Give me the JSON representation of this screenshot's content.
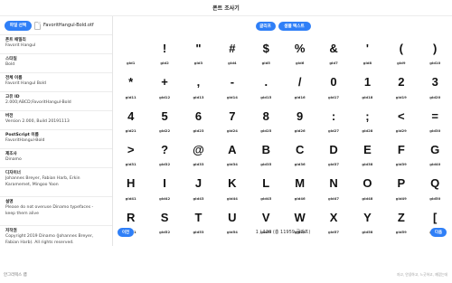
{
  "window": {
    "title": "폰트 조사기"
  },
  "file": {
    "select_label": "파일 선택",
    "file_name": "FavoritHangul-Bold.otf"
  },
  "info": [
    {
      "key": "폰트 패밀리",
      "lines": [
        "Favorit Hangul"
      ]
    },
    {
      "key": "스타일",
      "lines": [
        "Bold"
      ]
    },
    {
      "key": "전체 이름",
      "lines": [
        "Favorit Hangul Bold"
      ]
    },
    {
      "key": "고유 ID",
      "lines": [
        "2.000;ABCD;FavoritHangul-Bold"
      ]
    },
    {
      "key": "버전",
      "lines": [
        "Version 2.000, Build 20191113"
      ]
    },
    {
      "key": "PostScript 이름",
      "lines": [
        "FavoritHangul-Bold"
      ]
    },
    {
      "key": "제조사",
      "lines": [
        "Dinamo"
      ]
    },
    {
      "key": "디자이너",
      "lines": [
        "Johannes Breyer, Fabian Harb, Erkin",
        "Karamemet, Mingoo Yoon"
      ]
    },
    {
      "key": "설명",
      "lines": [
        "Please do not overuse Dinamo typefaces -",
        "keep them alive"
      ]
    },
    {
      "key": "저작권",
      "lines": [
        "Copyright 2019 Dinamo (Johannes Breyer,",
        "Fabian Harb). All rights reserved."
      ]
    }
  ],
  "toolbar": {
    "filter_label": "글리프",
    "sample_label": "샘플 텍스트"
  },
  "glyphs": [
    {
      "char": "",
      "gid": "gid1"
    },
    {
      "char": "!",
      "gid": "gid2"
    },
    {
      "char": "\"",
      "gid": "gid3"
    },
    {
      "char": "#",
      "gid": "gid4"
    },
    {
      "char": "$",
      "gid": "gid5"
    },
    {
      "char": "%",
      "gid": "gid6"
    },
    {
      "char": "&",
      "gid": "gid7"
    },
    {
      "char": "'",
      "gid": "gid8"
    },
    {
      "char": "(",
      "gid": "gid9"
    },
    {
      "char": ")",
      "gid": "gid10"
    },
    {
      "char": "*",
      "gid": "gid11"
    },
    {
      "char": "+",
      "gid": "gid12"
    },
    {
      "char": ",",
      "gid": "gid13"
    },
    {
      "char": "-",
      "gid": "gid14"
    },
    {
      "char": ".",
      "gid": "gid15"
    },
    {
      "char": "/",
      "gid": "gid16"
    },
    {
      "char": "0",
      "gid": "gid17"
    },
    {
      "char": "1",
      "gid": "gid18"
    },
    {
      "char": "2",
      "gid": "gid19"
    },
    {
      "char": "3",
      "gid": "gid20"
    },
    {
      "char": "4",
      "gid": "gid21"
    },
    {
      "char": "5",
      "gid": "gid22"
    },
    {
      "char": "6",
      "gid": "gid23"
    },
    {
      "char": "7",
      "gid": "gid24"
    },
    {
      "char": "8",
      "gid": "gid25"
    },
    {
      "char": "9",
      "gid": "gid26"
    },
    {
      "char": ":",
      "gid": "gid27"
    },
    {
      "char": ";",
      "gid": "gid28"
    },
    {
      "char": "<",
      "gid": "gid29"
    },
    {
      "char": "=",
      "gid": "gid30"
    },
    {
      "char": ">",
      "gid": "gid31"
    },
    {
      "char": "?",
      "gid": "gid32"
    },
    {
      "char": "@",
      "gid": "gid33"
    },
    {
      "char": "A",
      "gid": "gid34"
    },
    {
      "char": "B",
      "gid": "gid35"
    },
    {
      "char": "C",
      "gid": "gid36"
    },
    {
      "char": "D",
      "gid": "gid37"
    },
    {
      "char": "E",
      "gid": "gid38"
    },
    {
      "char": "F",
      "gid": "gid39"
    },
    {
      "char": "G",
      "gid": "gid40"
    },
    {
      "char": "H",
      "gid": "gid41"
    },
    {
      "char": "I",
      "gid": "gid42"
    },
    {
      "char": "J",
      "gid": "gid43"
    },
    {
      "char": "K",
      "gid": "gid44"
    },
    {
      "char": "L",
      "gid": "gid45"
    },
    {
      "char": "M",
      "gid": "gid46"
    },
    {
      "char": "N",
      "gid": "gid47"
    },
    {
      "char": "O",
      "gid": "gid48"
    },
    {
      "char": "P",
      "gid": "gid49"
    },
    {
      "char": "Q",
      "gid": "gid50"
    },
    {
      "char": "R",
      "gid": "gid51"
    },
    {
      "char": "S",
      "gid": "gid52"
    },
    {
      "char": "T",
      "gid": "gid53"
    },
    {
      "char": "U",
      "gid": "gid54"
    },
    {
      "char": "V",
      "gid": "gid55"
    },
    {
      "char": "W",
      "gid": "gid56"
    },
    {
      "char": "X",
      "gid": "gid57"
    },
    {
      "char": "Y",
      "gid": "gid58"
    },
    {
      "char": "Z",
      "gid": "gid59"
    },
    {
      "char": "[",
      "gid": "gid60"
    }
  ],
  "pager": {
    "prev_label": "이전",
    "page_info": "1 / 120 (총 11959 글리프)",
    "next_label": "다음"
  },
  "footer": {
    "left": "안그라픽스 랩",
    "right": "자고, 안녕하고, 느긋하고, 재밌는데"
  },
  "colors": {
    "accent": "#2f7ff7"
  },
  "icons": {
    "file": "file-icon"
  }
}
